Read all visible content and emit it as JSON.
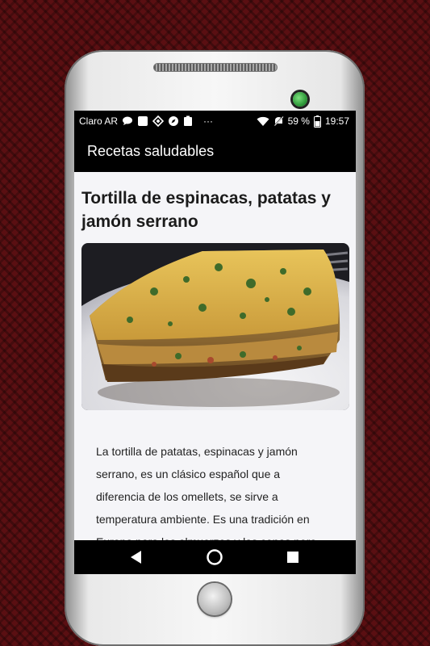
{
  "statusbar": {
    "carrier": "Claro AR",
    "battery": "59 %",
    "time": "19:57",
    "more": "···",
    "icons": [
      "chat-icon",
      "square-icon",
      "diamond-icon",
      "compass-icon",
      "clipboard-icon",
      "wifi-icon",
      "mute-icon",
      "battery-icon"
    ]
  },
  "appbar": {
    "title": "Recetas saludables"
  },
  "article": {
    "title": "Tortilla de espinacas, patatas y jamón serrano",
    "image": "tortilla-photo",
    "body": "La tortilla de patatas, espinacas y jamón serrano, es un clásico español que a diferencia de los omellets, se sirve a temperatura ambiente. Es una tradición en Europa para los almuerzos y las cenas pero"
  },
  "navbar": {
    "icons": [
      "back-icon",
      "home-icon",
      "recents-icon"
    ]
  },
  "colors": {
    "background": "#5a0f12",
    "appbar": "#000000",
    "screen": "#f5f5f8"
  }
}
